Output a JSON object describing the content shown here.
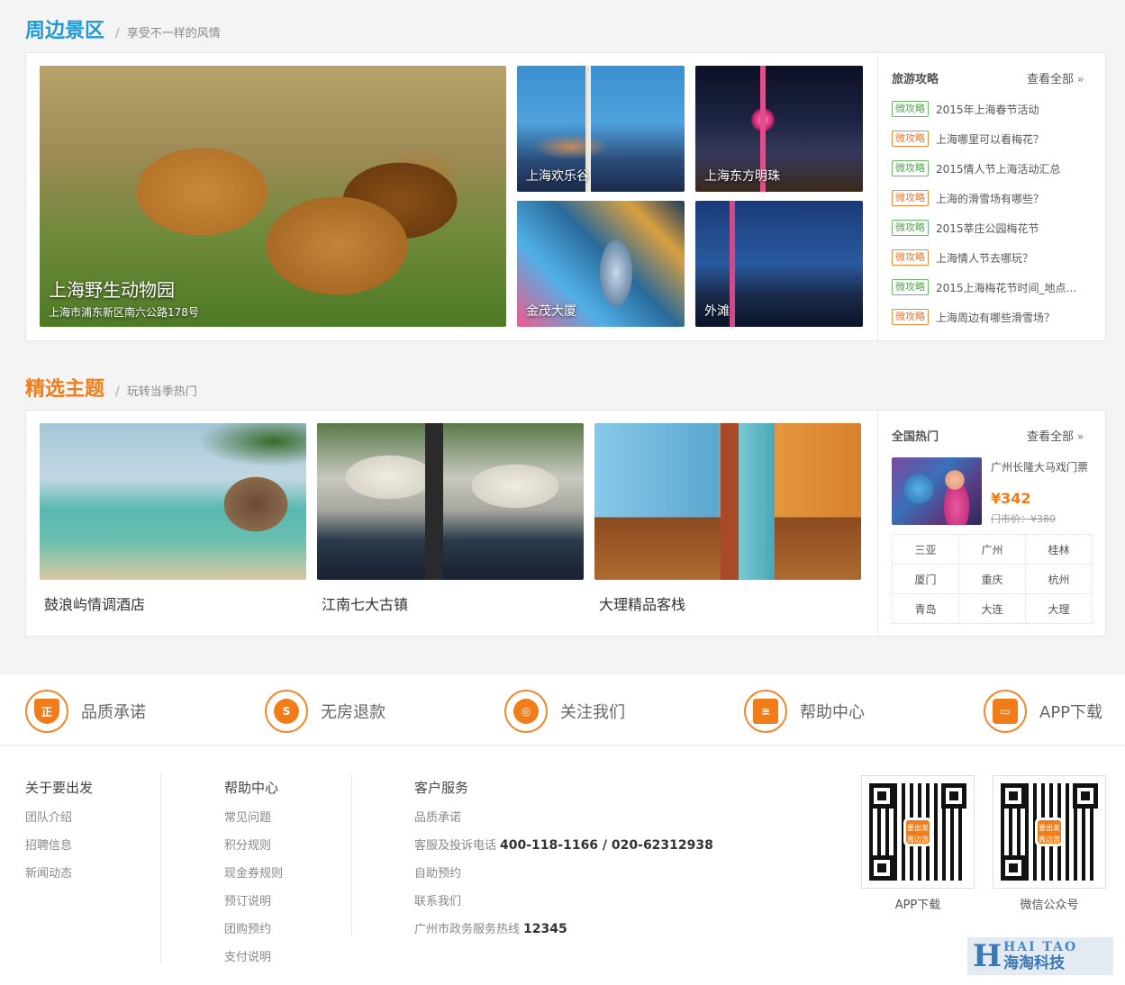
{
  "scenic": {
    "title": "周边景区",
    "subtitle": "享受不一样的风情",
    "slash": "/",
    "main": {
      "name": "上海野生动物园",
      "address": "上海市浦东新区南六公路178号"
    },
    "tiles": [
      "上海欢乐谷",
      "上海东方明珠",
      "金茂大厦",
      "外滩"
    ],
    "side": {
      "title": "旅游攻略",
      "more": "查看全部",
      "more_arrow": "»",
      "items": [
        {
          "tag": "微攻略",
          "color": "green",
          "text": "2015年上海春节活动"
        },
        {
          "tag": "微攻略",
          "color": "orange",
          "text": "上海哪里可以看梅花？"
        },
        {
          "tag": "微攻略",
          "color": "green",
          "text": "2015情人节上海活动汇总"
        },
        {
          "tag": "微攻略",
          "color": "orange",
          "text": "上海的滑雪场有哪些？"
        },
        {
          "tag": "微攻略",
          "color": "green",
          "text": "2015莘庄公园梅花节"
        },
        {
          "tag": "微攻略",
          "color": "orange",
          "text": "上海情人节去哪玩？"
        },
        {
          "tag": "微攻略",
          "color": "green",
          "text": "2015上海梅花节时间_地点..."
        },
        {
          "tag": "微攻略",
          "color": "orange",
          "text": "上海周边有哪些滑雪场？"
        }
      ]
    }
  },
  "themes": {
    "title": "精选主题",
    "subtitle": "玩转当季热门",
    "slash": "/",
    "cards": [
      "鼓浪屿情调酒店",
      "江南七大古镇",
      "大理精品客栈"
    ],
    "side": {
      "title": "全国热门",
      "more": "查看全部",
      "more_arrow": "»",
      "product": {
        "name": "广州长隆大马戏门票",
        "price": "¥342",
        "market_price": "门市价：¥380"
      },
      "cities": [
        [
          "三亚",
          "广州",
          "桂林"
        ],
        [
          "厦门",
          "重庆",
          "杭州"
        ],
        [
          "青岛",
          "大连",
          "大理"
        ]
      ]
    }
  },
  "features": [
    {
      "label": "品质承诺",
      "glyph": "正"
    },
    {
      "label": "无房退款",
      "glyph": "S"
    },
    {
      "label": "关注我们",
      "glyph": "◎"
    },
    {
      "label": "帮助中心",
      "glyph": "≡"
    },
    {
      "label": "APP下载",
      "glyph": "▭"
    }
  ],
  "footer": {
    "about": {
      "title": "关于要出发",
      "links": [
        "团队介绍",
        "招聘信息",
        "新闻动态"
      ]
    },
    "help": {
      "title": "帮助中心",
      "links": [
        "常见问题",
        "积分规则",
        "现金券规则",
        "预订说明",
        "团购预约",
        "支付说明"
      ]
    },
    "service": {
      "title": "客户服务",
      "quality": "品质承诺",
      "complaint_label": "客服及投诉电话",
      "complaint_phone": "400-118-1166 / 020-62312938",
      "self_booking": "自助预约",
      "contact": "联系我们",
      "gov_label": "广州市政务服务热线",
      "gov_phone": "12345"
    },
    "qr": [
      {
        "caption": "APP下载",
        "logo": "要出发 周边游"
      },
      {
        "caption": "微信公众号",
        "logo": "要出发 周边游"
      }
    ]
  },
  "watermark": {
    "en": "HAI TAO",
    "cn": "海淘科技",
    "mark": "H"
  }
}
